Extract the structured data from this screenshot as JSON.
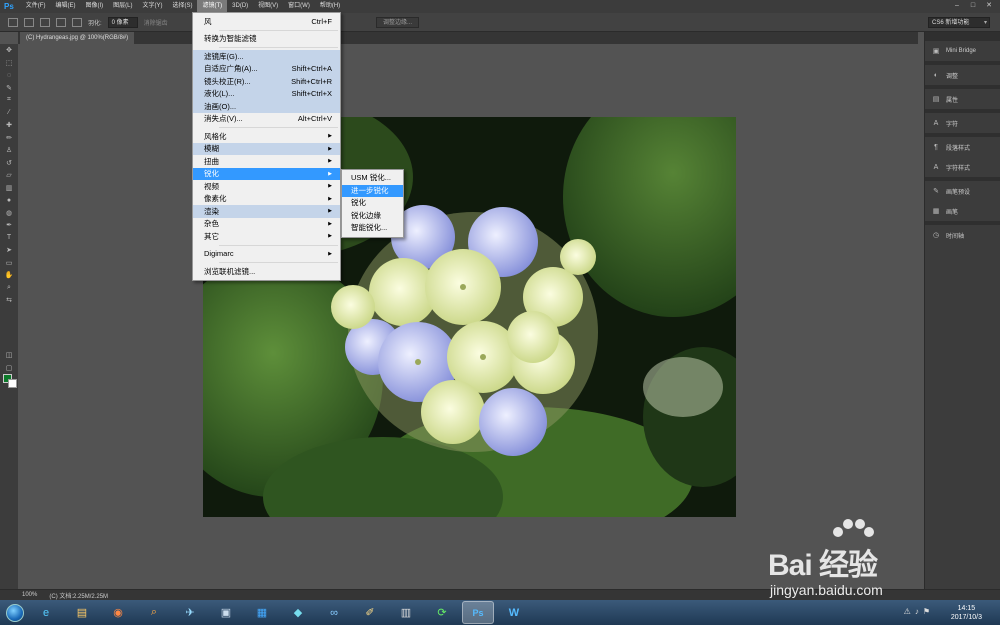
{
  "menubar": {
    "logo": "Ps",
    "items": [
      "文件(F)",
      "编辑(E)",
      "图像(I)",
      "图层(L)",
      "文字(Y)",
      "选择(S)",
      "滤镜(T)",
      "3D(D)",
      "视图(V)",
      "窗口(W)",
      "帮助(H)"
    ],
    "active_index": 6
  },
  "options": {
    "feather_label": "羽化:",
    "feather_value": "0 像素",
    "antialias": "消除锯齿",
    "refine_edge": "调整边缘..."
  },
  "workspace": "CS6 新增功能",
  "doc_tab": "(C) Hydrangeas.jpg @ 100%(RGB/8#)",
  "filter_menu": {
    "items": [
      {
        "label": "风",
        "shortcut": "Ctrl+F",
        "state": "normal"
      },
      {
        "sep": true
      },
      {
        "label": "转换为智能滤镜",
        "shortcut": "",
        "state": "normal"
      },
      {
        "sep": true
      },
      {
        "label": "滤镜库(G)...",
        "shortcut": "",
        "state": "hl"
      },
      {
        "label": "自适应广角(A)...",
        "shortcut": "Shift+Ctrl+A",
        "state": "hl"
      },
      {
        "label": "镜头校正(R)...",
        "shortcut": "Shift+Ctrl+R",
        "state": "hl"
      },
      {
        "label": "液化(L)...",
        "shortcut": "Shift+Ctrl+X",
        "state": "hl"
      },
      {
        "label": "油画(O)...",
        "shortcut": "",
        "state": "hl"
      },
      {
        "label": "消失点(V)...",
        "shortcut": "Alt+Ctrl+V",
        "state": "normal"
      },
      {
        "sep": true
      },
      {
        "label": "风格化",
        "arrow": true,
        "state": "normal"
      },
      {
        "label": "模糊",
        "arrow": true,
        "state": "hl"
      },
      {
        "label": "扭曲",
        "arrow": true,
        "state": "normal"
      },
      {
        "label": "锐化",
        "arrow": true,
        "state": "sel"
      },
      {
        "label": "视频",
        "arrow": true,
        "state": "normal"
      },
      {
        "label": "像素化",
        "arrow": true,
        "state": "normal"
      },
      {
        "label": "渲染",
        "arrow": true,
        "state": "hl"
      },
      {
        "label": "杂色",
        "arrow": true,
        "state": "normal"
      },
      {
        "label": "其它",
        "arrow": true,
        "state": "normal"
      },
      {
        "sep": true
      },
      {
        "label": "Digimarc",
        "arrow": true,
        "state": "normal"
      },
      {
        "sep": true
      },
      {
        "label": "浏览联机滤镜...",
        "shortcut": "",
        "state": "normal"
      }
    ]
  },
  "sharpen_submenu": {
    "items": [
      {
        "label": "USM 锐化...",
        "state": "normal"
      },
      {
        "label": "进一步锐化",
        "state": "sel"
      },
      {
        "label": "锐化",
        "state": "normal"
      },
      {
        "label": "锐化边缘",
        "state": "normal"
      },
      {
        "label": "智能锐化...",
        "state": "normal"
      }
    ]
  },
  "panels": [
    {
      "icon": "▣",
      "label": "Mini Bridge"
    },
    {
      "sep": true
    },
    {
      "icon": "◐",
      "label": "调整"
    },
    {
      "sep": true
    },
    {
      "icon": "▤",
      "label": "属性"
    },
    {
      "sep": true
    },
    {
      "icon": "A",
      "label": "字符"
    },
    {
      "sep": true
    },
    {
      "icon": "¶",
      "label": "段落样式"
    },
    {
      "icon": "A",
      "label": "字符样式"
    },
    {
      "sep": true
    },
    {
      "icon": "✎",
      "label": "画笔预设"
    },
    {
      "icon": "▦",
      "label": "画笔"
    },
    {
      "sep": true
    },
    {
      "icon": "◷",
      "label": "时间轴"
    }
  ],
  "status": {
    "zoom": "100%",
    "doc": "(C) 文档:2.25M/2.25M"
  },
  "taskbar": {
    "apps": [
      "e",
      "▤",
      "◉",
      "⌕",
      "✈",
      "▣",
      "▦",
      "◆",
      "∞",
      "✐",
      "▥",
      "⟳",
      "Ps",
      "W"
    ],
    "active_index": 12,
    "time": "14:15",
    "date": "2017/10/3"
  },
  "watermark": {
    "brand": "Bai   经验",
    "url": "jingyan.baidu.com"
  },
  "colors": {
    "foreground": "#0c7a2a",
    "background": "#ffffff",
    "menu_highlight": "#c4d4e9",
    "menu_selected": "#3399ff"
  }
}
